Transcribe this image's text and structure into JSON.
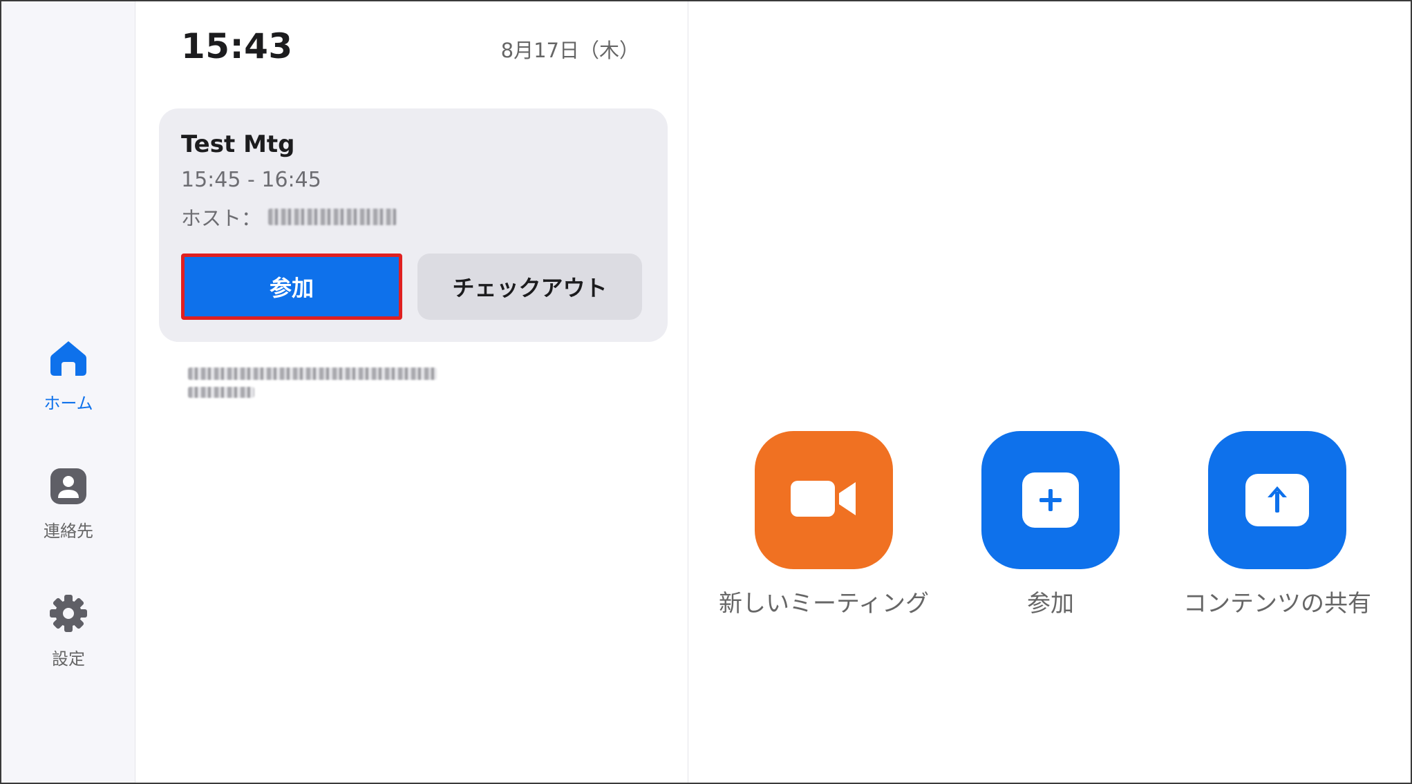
{
  "sidebar": {
    "items": [
      {
        "label": "ホーム",
        "icon": "home-icon",
        "active": true
      },
      {
        "label": "連絡先",
        "icon": "contact-icon",
        "active": false
      },
      {
        "label": "設定",
        "icon": "gear-icon",
        "active": false
      }
    ]
  },
  "header": {
    "clock": "15:43",
    "date": "8月17日（木）"
  },
  "meeting_card": {
    "title": "Test Mtg",
    "time": "15:45 - 16:45",
    "host_label": "ホスト：",
    "join_label": "参加",
    "checkout_label": "チェックアウト"
  },
  "actions": [
    {
      "label": "新しいミーティング",
      "icon": "video-camera-icon",
      "color": "#f07122"
    },
    {
      "label": "参加",
      "icon": "plus-icon",
      "color": "#0e71eb"
    },
    {
      "label": "コンテンツの共有",
      "icon": "upload-arrow-icon",
      "color": "#0e71eb"
    }
  ],
  "colors": {
    "accent": "#0e71eb",
    "orange": "#f07122",
    "highlight_border": "#e02020"
  }
}
